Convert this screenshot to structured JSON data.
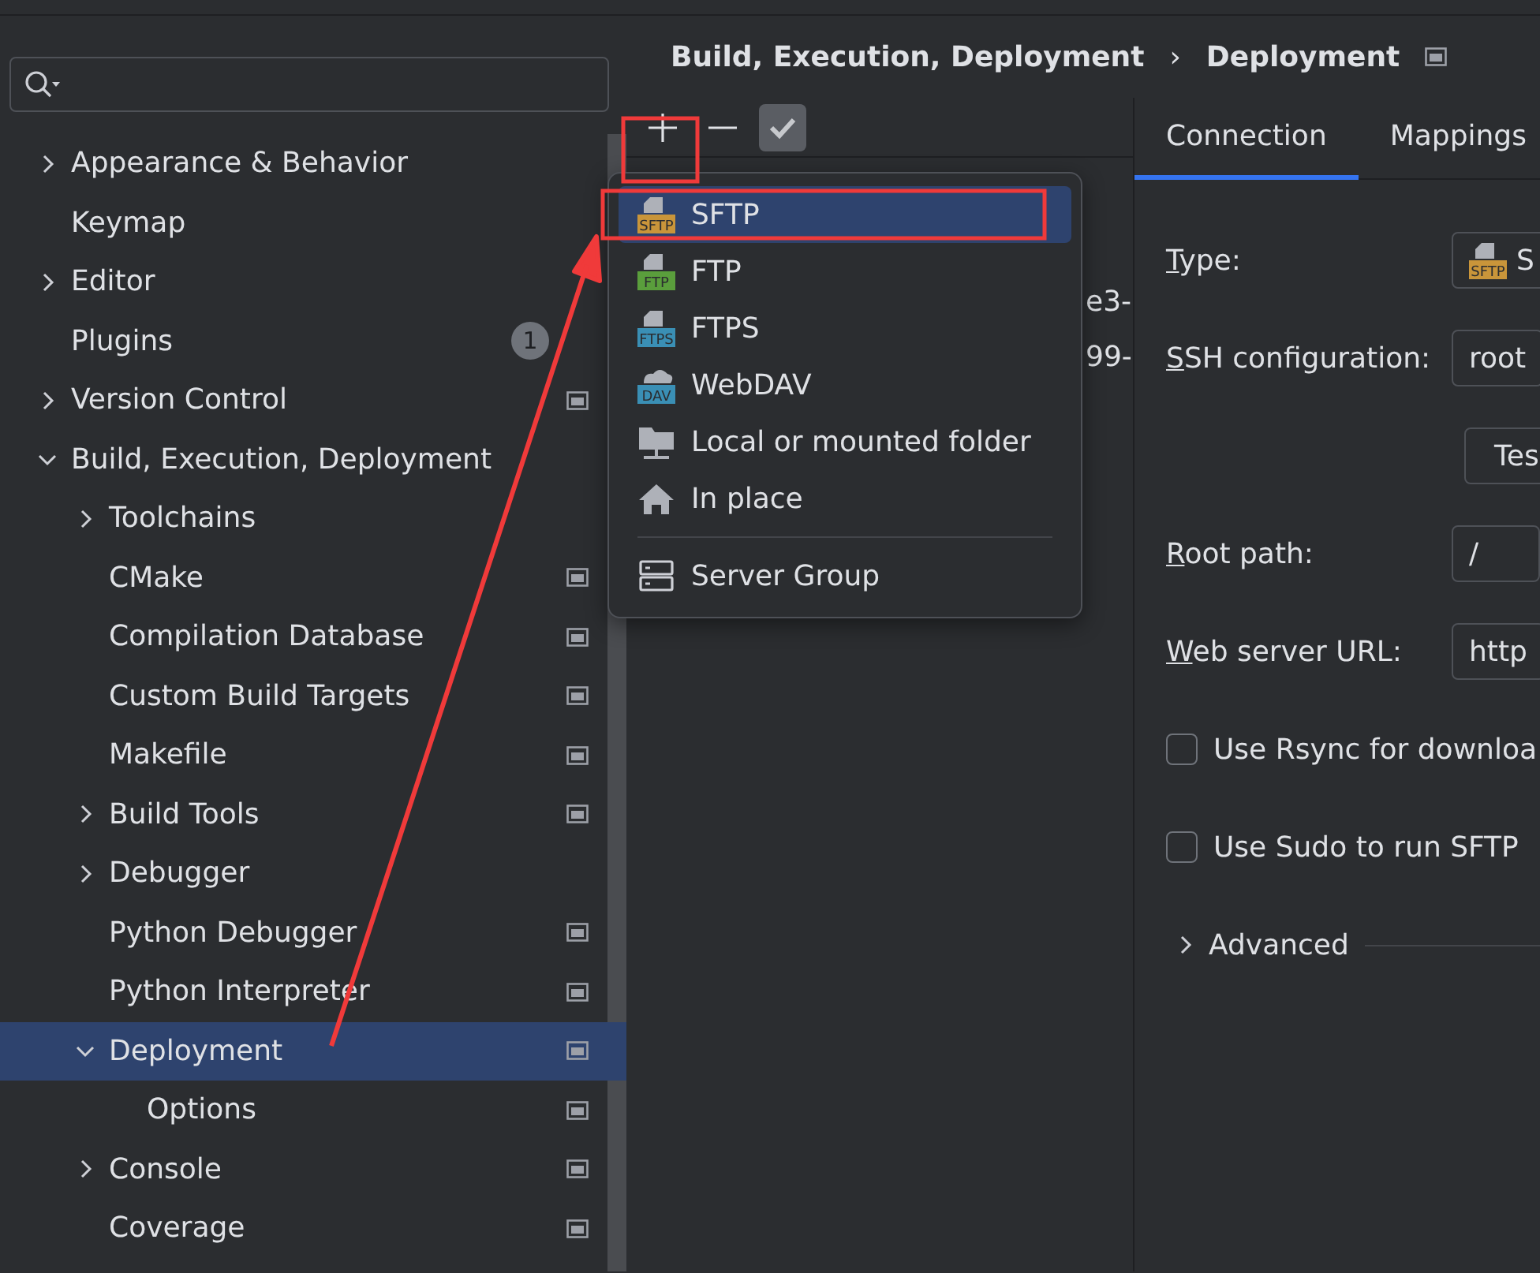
{
  "tree": [
    {
      "label": "Appearance & Behavior",
      "expanded": false,
      "selected": false,
      "project_scoped": false
    },
    {
      "label": "Keymap",
      "selected": false,
      "project_scoped": false
    },
    {
      "label": "Editor",
      "expanded": false,
      "selected": false,
      "project_scoped": false
    },
    {
      "label": "Plugins",
      "selected": false,
      "badge": "1",
      "project_scoped": false
    },
    {
      "label": "Version Control",
      "expanded": false,
      "selected": false,
      "project_scoped": true
    },
    {
      "label": "Build, Execution, Deployment",
      "expanded": true,
      "selected": false,
      "project_scoped": false,
      "children": [
        {
          "label": "Toolchains",
          "expanded": false,
          "selected": false,
          "project_scoped": false
        },
        {
          "label": "CMake",
          "selected": false,
          "project_scoped": true
        },
        {
          "label": "Compilation Database",
          "selected": false,
          "project_scoped": true
        },
        {
          "label": "Custom Build Targets",
          "selected": false,
          "project_scoped": true
        },
        {
          "label": "Makefile",
          "selected": false,
          "project_scoped": true
        },
        {
          "label": "Build Tools",
          "expanded": false,
          "selected": false,
          "project_scoped": true
        },
        {
          "label": "Debugger",
          "expanded": false,
          "selected": false,
          "project_scoped": false
        },
        {
          "label": "Python Debugger",
          "selected": false,
          "project_scoped": true
        },
        {
          "label": "Python Interpreter",
          "selected": false,
          "project_scoped": true
        },
        {
          "label": "Deployment",
          "expanded": true,
          "selected": true,
          "project_scoped": true,
          "children": [
            {
              "label": "Options",
              "selected": false,
              "project_scoped": true
            }
          ]
        },
        {
          "label": "Console",
          "expanded": false,
          "selected": false,
          "project_scoped": true
        },
        {
          "label": "Coverage",
          "selected": false,
          "project_scoped": true
        }
      ]
    }
  ],
  "breadcrumb": {
    "parent": "Build, Execution, Deployment",
    "separator": "›",
    "current": "Deployment"
  },
  "toolbar": [
    {
      "kind": "add"
    },
    {
      "kind": "remove"
    },
    {
      "kind": "default",
      "disabled": true
    }
  ],
  "servers": [
    "e3-",
    "99-"
  ],
  "add_menu": [
    {
      "kind": "protocol",
      "label": "SFTP",
      "tag": "SFTP",
      "color": "#c9953a",
      "selected": true
    },
    {
      "kind": "protocol",
      "label": "FTP",
      "tag": "FTP",
      "color": "#5a9e3c",
      "selected": false
    },
    {
      "kind": "protocol",
      "label": "FTPS",
      "tag": "FTPS",
      "color": "#3a8fb5",
      "selected": false
    },
    {
      "kind": "cloud",
      "label": "WebDAV",
      "tag": "DAV",
      "color": "#3a8fb5",
      "selected": false
    },
    {
      "kind": "folder",
      "label": "Local or mounted folder",
      "selected": false
    },
    {
      "kind": "home",
      "label": "In place",
      "selected": false
    },
    {
      "kind": "separator"
    },
    {
      "kind": "group",
      "label": "Server Group",
      "selected": false
    }
  ],
  "tabs": [
    {
      "label": "Connection",
      "selected": true
    },
    {
      "label": "Mappings",
      "selected": false
    }
  ],
  "form": [
    {
      "kind": "select",
      "label": "Type:",
      "value": "S",
      "tag": "SFTP",
      "color": "#c9953a"
    },
    {
      "kind": "select",
      "label": "SSH configuration:",
      "value": "root"
    },
    {
      "kind": "button",
      "label": "Tes"
    },
    {
      "kind": "text",
      "label": "Root path:",
      "value": "/"
    },
    {
      "kind": "text",
      "label": "Web server URL:",
      "value": "http"
    },
    {
      "kind": "checkbox",
      "label": "Use Rsync for downloa",
      "checked": false
    },
    {
      "kind": "checkbox",
      "label": "Use Sudo to run SFTP",
      "checked": false
    },
    {
      "kind": "expander",
      "label": "Advanced",
      "expanded": false
    }
  ]
}
